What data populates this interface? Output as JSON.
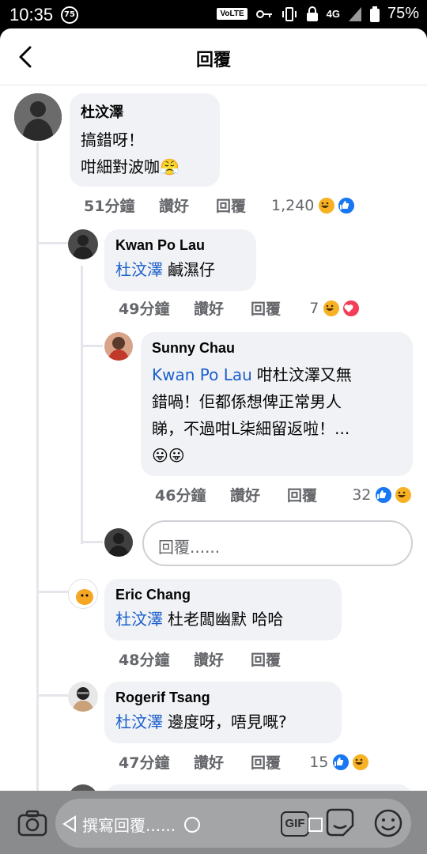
{
  "status_bar": {
    "time": "10:35",
    "badge": "75",
    "network": "VoLTE",
    "signal_label": "4G",
    "battery": "75%"
  },
  "header": {
    "title": "回覆"
  },
  "comments": [
    {
      "author": "杜汶澤",
      "lines": [
        "搞錯呀！",
        "咁細對波咖"
      ],
      "emoji": "😤",
      "time": "51分鐘",
      "like_label": "讚好",
      "reply_label": "回覆",
      "reaction_count": "1,240",
      "reactions": [
        "haha-icon",
        "like-icon"
      ]
    },
    {
      "author": "Kwan Po Lau",
      "mention": "杜汶澤",
      "text": "鹹濕仔",
      "time": "49分鐘",
      "like_label": "讚好",
      "reply_label": "回覆",
      "reaction_count": "7",
      "reactions": [
        "haha-icon",
        "love-icon"
      ]
    },
    {
      "author": "Sunny Chau",
      "mention": "Kwan Po Lau",
      "lines": [
        "咁杜汶澤又無",
        "錯喎！佢都係想俾正常男人",
        "睇，不過咁L柒細留返啦！..."
      ],
      "emoji": "😛😛",
      "time": "46分鐘",
      "like_label": "讚好",
      "reply_label": "回覆",
      "reaction_count": "32",
      "reactions": [
        "like-icon",
        "haha-icon"
      ]
    },
    {
      "author": "Eric Chang",
      "mention": "杜汶澤",
      "text": "杜老闆幽默 哈哈",
      "time": "48分鐘",
      "like_label": "讚好",
      "reply_label": "回覆"
    },
    {
      "author": "Rogerif Tsang",
      "mention": "杜汶澤",
      "text": "邊度呀，唔見嘅?",
      "time": "47分鐘",
      "like_label": "讚好",
      "reply_label": "回覆",
      "reaction_count": "15",
      "reactions": [
        "like-icon",
        "haha-icon"
      ]
    }
  ],
  "reply_input": {
    "placeholder": "回覆......"
  },
  "composer": {
    "placeholder": "撰寫回覆......",
    "gif_label": "GIF"
  },
  "colors": {
    "mention": "#1b5fcc",
    "like_blue": "#1877f2",
    "love_red": "#f33e58",
    "haha_yellow": "#f7b125",
    "bubble_bg": "#f0f2f5"
  }
}
